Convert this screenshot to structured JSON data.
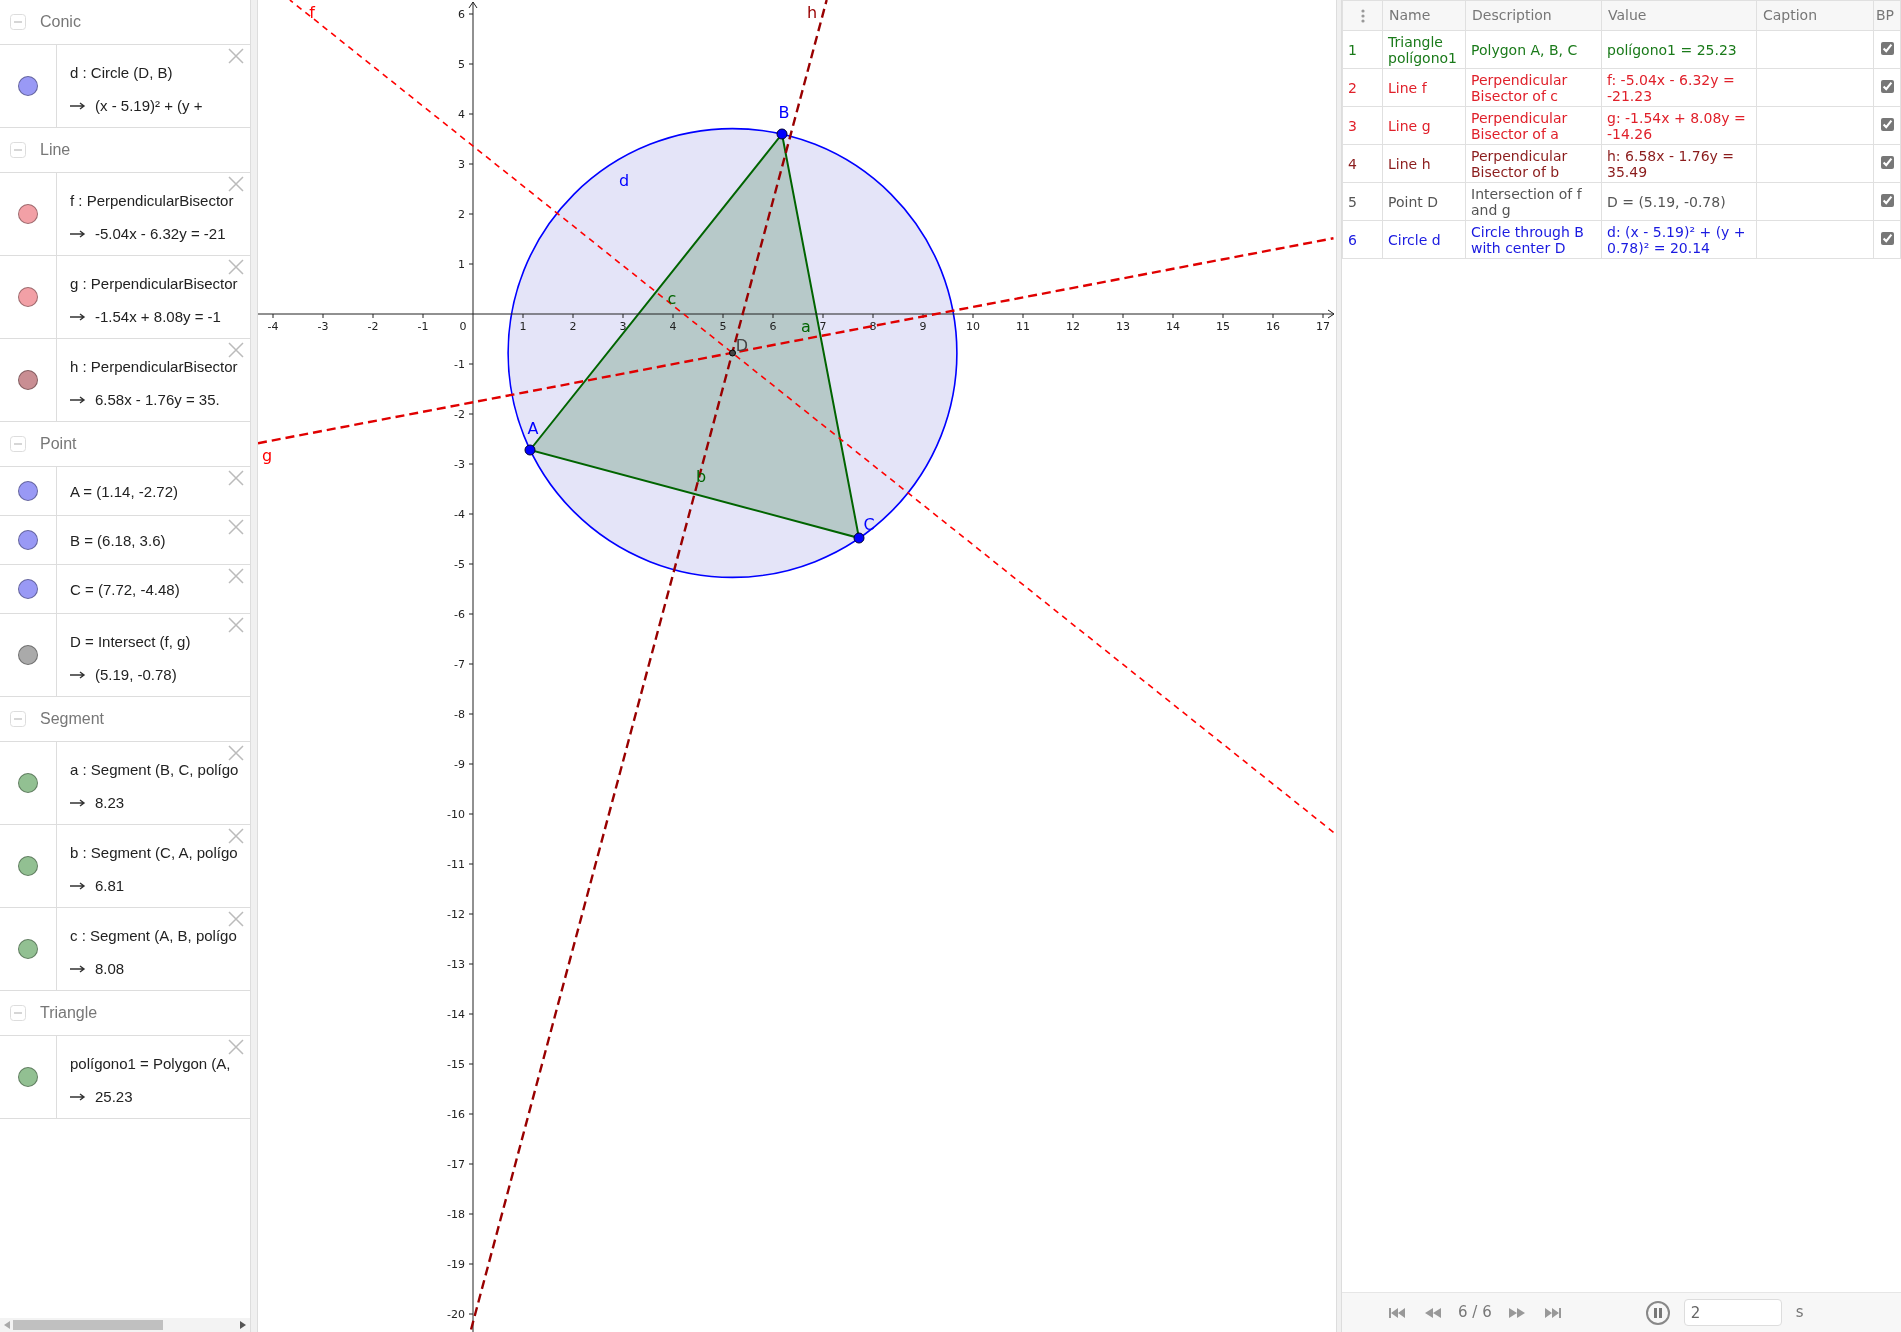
{
  "algebra": {
    "groups": [
      {
        "title": "Conic",
        "expanded": true,
        "items": [
          {
            "definition": "d : Circle (D, B)",
            "value": "(x - 5.19)² + (y +",
            "color": "#9999f5"
          }
        ]
      },
      {
        "title": "Line",
        "expanded": true,
        "items": [
          {
            "definition": "f : PerpendicularBisector",
            "value": "-5.04x - 6.32y = -21",
            "color": "#f2a0a6"
          },
          {
            "definition": "g : PerpendicularBisector",
            "value": "-1.54x + 8.08y = -1",
            "color": "#f2a0a6"
          },
          {
            "definition": "h : PerpendicularBisector",
            "value": "6.58x - 1.76y = 35.",
            "color": "#c98e93"
          }
        ]
      },
      {
        "title": "Point",
        "expanded": true,
        "items": [
          {
            "definition": "A = (1.14, -2.72)",
            "color": "#9999f5"
          },
          {
            "definition": "B = (6.18, 3.6)",
            "color": "#9999f5"
          },
          {
            "definition": "C = (7.72, -4.48)",
            "color": "#9999f5"
          },
          {
            "definition": "D = Intersect (f, g)",
            "value": "(5.19, -0.78)",
            "color": "#aaaaaa"
          }
        ]
      },
      {
        "title": "Segment",
        "expanded": true,
        "items": [
          {
            "definition": "a : Segment (B, C, polígo",
            "value": "8.23",
            "color": "#92c092"
          },
          {
            "definition": "b : Segment (C, A, polígo",
            "value": "6.81",
            "color": "#92c092"
          },
          {
            "definition": "c : Segment (A, B, polígo",
            "value": "8.08",
            "color": "#92c092"
          }
        ]
      },
      {
        "title": "Triangle",
        "expanded": true,
        "items": [
          {
            "definition": "polígono1 = Polygon (A,",
            "value": "25.23",
            "color": "#92c092"
          }
        ]
      }
    ]
  },
  "graphics": {
    "x_ticks": [
      "-4",
      "-3",
      "-2",
      "-1",
      "0",
      "1",
      "2",
      "3",
      "4",
      "5",
      "6",
      "7",
      "8",
      "9",
      "10",
      "11",
      "12",
      "13",
      "14",
      "15",
      "16",
      "17"
    ],
    "y_ticks": [
      "6",
      "5",
      "4",
      "3",
      "2",
      "1",
      "-1",
      "-2",
      "-3",
      "-4",
      "-5",
      "-6",
      "-7",
      "-8",
      "-9",
      "-10",
      "-11",
      "-12",
      "-13",
      "-14",
      "-15",
      "-16",
      "-17",
      "-18",
      "-19",
      "-20"
    ],
    "labels": [
      {
        "text": "f",
        "color": "#ff0000"
      },
      {
        "text": "h",
        "color": "#990000"
      },
      {
        "text": "g",
        "color": "#ff0000"
      },
      {
        "text": "d",
        "color": "#0000ff"
      },
      {
        "text": "B",
        "color": "#0000ff"
      },
      {
        "text": "A",
        "color": "#0000ff"
      },
      {
        "text": "C",
        "color": "#0000ff"
      },
      {
        "text": "c",
        "color": "#006400"
      },
      {
        "text": "a",
        "color": "#006400"
      },
      {
        "text": "b",
        "color": "#006400"
      },
      {
        "text": "D",
        "color": "#444444"
      }
    ]
  },
  "table": {
    "columns": [
      "Name",
      "Description",
      "Value",
      "Caption",
      "BP"
    ],
    "rows": [
      {
        "number": "1",
        "name": "Triangle polígono1",
        "description": "Polygon A, B, C",
        "value": "polígono1 = 25.23",
        "bp_checked": true,
        "color": "#1a7a1a"
      },
      {
        "number": "2",
        "name": "Line f",
        "description": "Perpendicular Bisector of c",
        "value": "f: -5.04x - 6.32y = -21.23",
        "bp_checked": true,
        "color": "#e0202a"
      },
      {
        "number": "3",
        "name": "Line g",
        "description": "Perpendicular Bisector of a",
        "value": "g: -1.54x + 8.08y = -14.26",
        "bp_checked": true,
        "color": "#e0202a"
      },
      {
        "number": "4",
        "name": "Line h",
        "description": "Perpendicular Bisector of b",
        "value": "h: 6.58x - 1.76y = 35.49",
        "bp_checked": true,
        "color": "#8b1c1c"
      },
      {
        "number": "5",
        "name": "Point D",
        "description": "Intersection of f and g",
        "value": "D = (5.19, -0.78)",
        "bp_checked": true,
        "color": "#555555"
      },
      {
        "number": "6",
        "name": "Circle d",
        "description": "Circle through B with center D",
        "value": "d: (x - 5.19)² + (y + 0.78)² = 20.14",
        "bp_checked": true,
        "color": "#1a1ae0"
      }
    ]
  },
  "player": {
    "counter": "6 / 6",
    "playing": true,
    "speed": "2",
    "unit": "s"
  }
}
